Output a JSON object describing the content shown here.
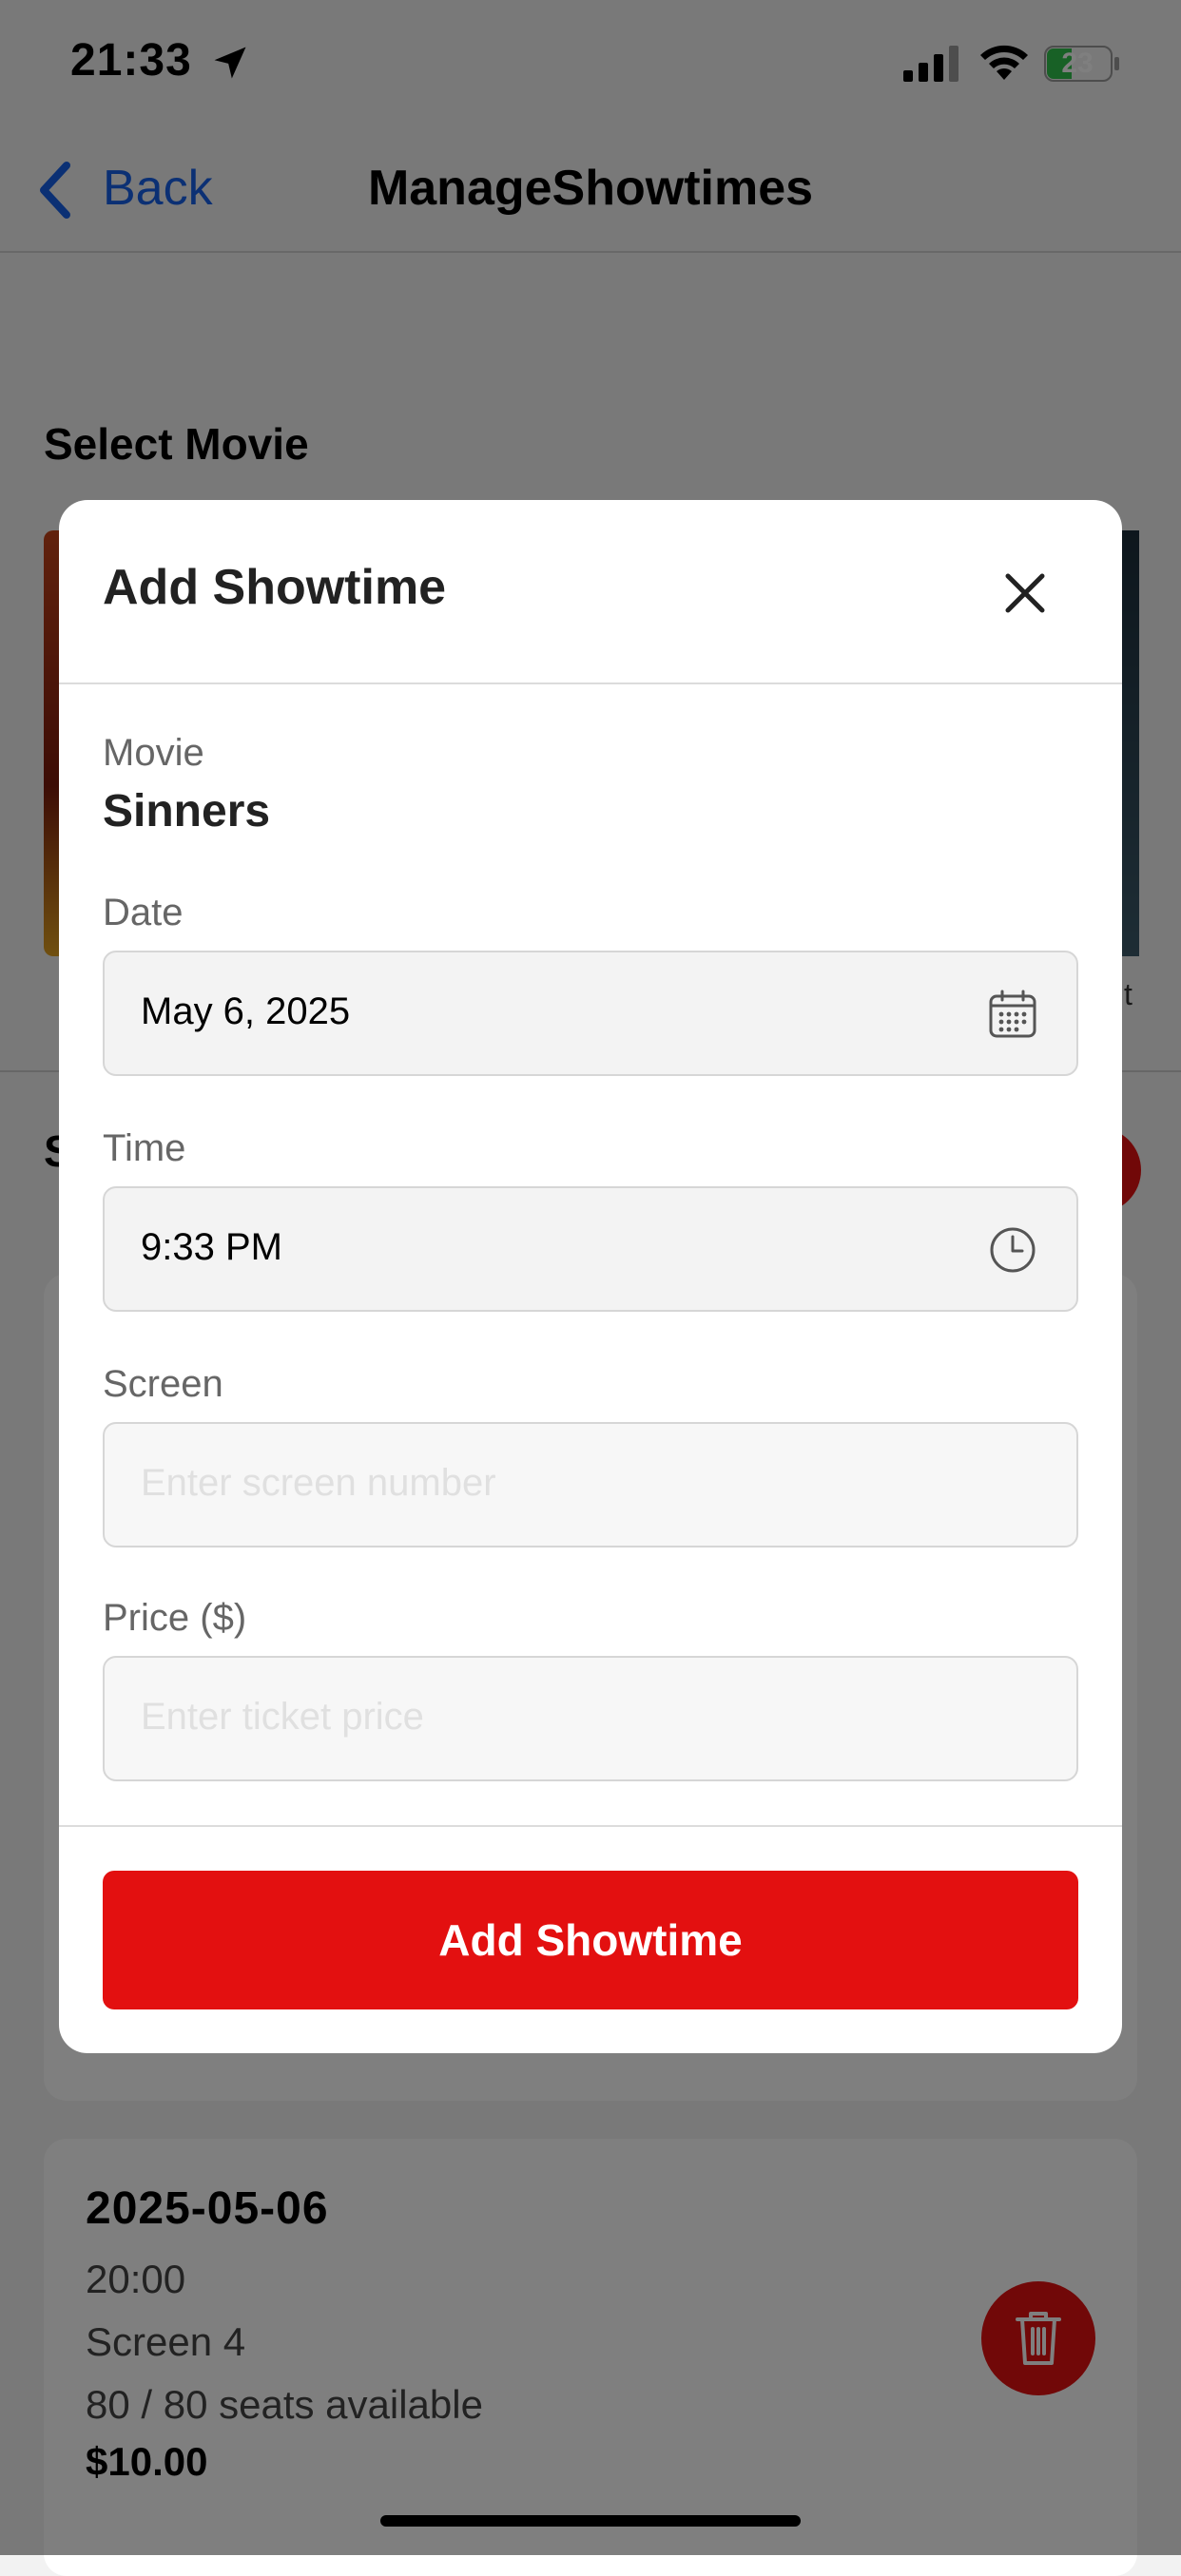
{
  "status_bar": {
    "time": "21:33",
    "battery": "23"
  },
  "nav": {
    "back_label": "Back",
    "title": "ManageShowtimes"
  },
  "page": {
    "select_movie_label": "Select Movie",
    "poster_right_caption": "t",
    "section_initial": "S"
  },
  "showtime_card": {
    "date": "2025-05-06",
    "time": "20:00",
    "screen": "Screen 4",
    "seats": "80 / 80 seats available",
    "price": "$10.00"
  },
  "modal": {
    "title": "Add Showtime",
    "movie_label": "Movie",
    "movie_value": "Sinners",
    "date_label": "Date",
    "date_value": "May 6, 2025",
    "time_label": "Time",
    "time_value": "9:33 PM",
    "screen_label": "Screen",
    "screen_placeholder": "Enter screen number",
    "price_label": "Price ($)",
    "price_placeholder": "Enter ticket price",
    "submit_label": "Add Showtime"
  },
  "colors": {
    "accent": "#e31010",
    "link": "#1660e8"
  }
}
